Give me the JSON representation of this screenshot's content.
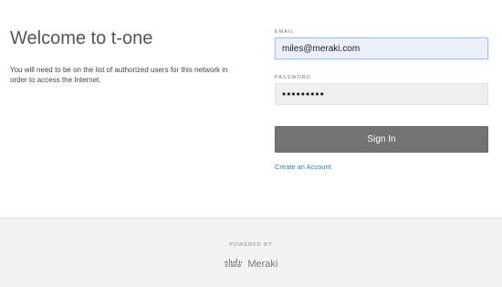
{
  "welcome": {
    "title": "Welcome to t-one",
    "message": "You will need to be on the list of authorized users for this network in order to access the Internet."
  },
  "form": {
    "email_label": "EMAIL",
    "email_value": "miles@meraki.com",
    "password_label": "PASSWORD",
    "password_value": "•••••••••",
    "signin_label": "Sign In",
    "create_account_label": "Create an Account"
  },
  "footer": {
    "powered_by": "POWERED BY",
    "cisco_text": "cisco",
    "meraki_text": "Meraki"
  },
  "colors": {
    "button": "#737373",
    "link": "#1f7fc6",
    "footer_bg": "#f2f2f2",
    "focus_border": "#a8c6ea"
  }
}
